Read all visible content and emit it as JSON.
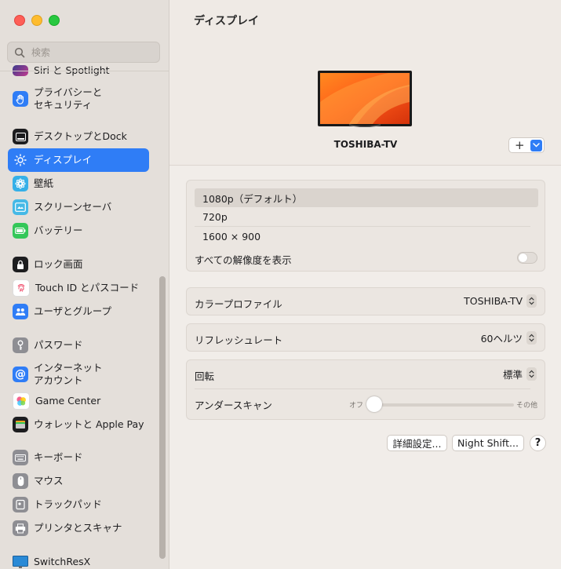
{
  "search": {
    "placeholder": "検索"
  },
  "sidebar": {
    "items": [
      {
        "label": "Siri と Spotlight",
        "icon": "siri-icon"
      },
      {
        "label": "プライバシーと\nセキュリティ",
        "icon": "hand-icon"
      },
      {
        "label": "デスクトップとDock",
        "icon": "dock-icon"
      },
      {
        "label": "ディスプレイ",
        "icon": "sun-icon"
      },
      {
        "label": "壁紙",
        "icon": "flower-icon"
      },
      {
        "label": "スクリーンセーバ",
        "icon": "screensaver-icon"
      },
      {
        "label": "バッテリー",
        "icon": "battery-icon"
      },
      {
        "label": "ロック画面",
        "icon": "lock-icon"
      },
      {
        "label": "Touch ID とパスコード",
        "icon": "fingerprint-icon"
      },
      {
        "label": "ユーザとグループ",
        "icon": "users-icon"
      },
      {
        "label": "パスワード",
        "icon": "key-icon"
      },
      {
        "label": "インターネット\nアカウント",
        "icon": "at-icon"
      },
      {
        "label": "Game Center",
        "icon": "game-center-icon"
      },
      {
        "label": "ウォレットと Apple Pay",
        "icon": "wallet-icon"
      },
      {
        "label": "キーボード",
        "icon": "keyboard-icon"
      },
      {
        "label": "マウス",
        "icon": "mouse-icon"
      },
      {
        "label": "トラックパッド",
        "icon": "trackpad-icon"
      },
      {
        "label": "プリンタとスキャナ",
        "icon": "printer-icon"
      },
      {
        "label": "SwitchResX",
        "icon": "monitor-icon"
      }
    ]
  },
  "main": {
    "title": "ディスプレイ",
    "display_name": "TOSHIBA-TV",
    "add_label": "+",
    "resolutions": [
      "1080p（デフォルト）",
      "720p",
      "1600 × 900"
    ],
    "show_all_label": "すべての解像度を表示",
    "color_profile": {
      "label": "カラープロファイル",
      "value": "TOSHIBA-TV"
    },
    "refresh": {
      "label": "リフレッシュレート",
      "value": "60ヘルツ"
    },
    "rotation": {
      "label": "回転",
      "value": "標準"
    },
    "underscan": {
      "label": "アンダースキャン",
      "min_label": "オフ",
      "max_label": "その他",
      "value": 0
    },
    "advanced_button": "詳細設定...",
    "night_shift_button": "Night Shift...",
    "help_label": "?"
  },
  "colors": {
    "accent": "#2f7df6"
  }
}
